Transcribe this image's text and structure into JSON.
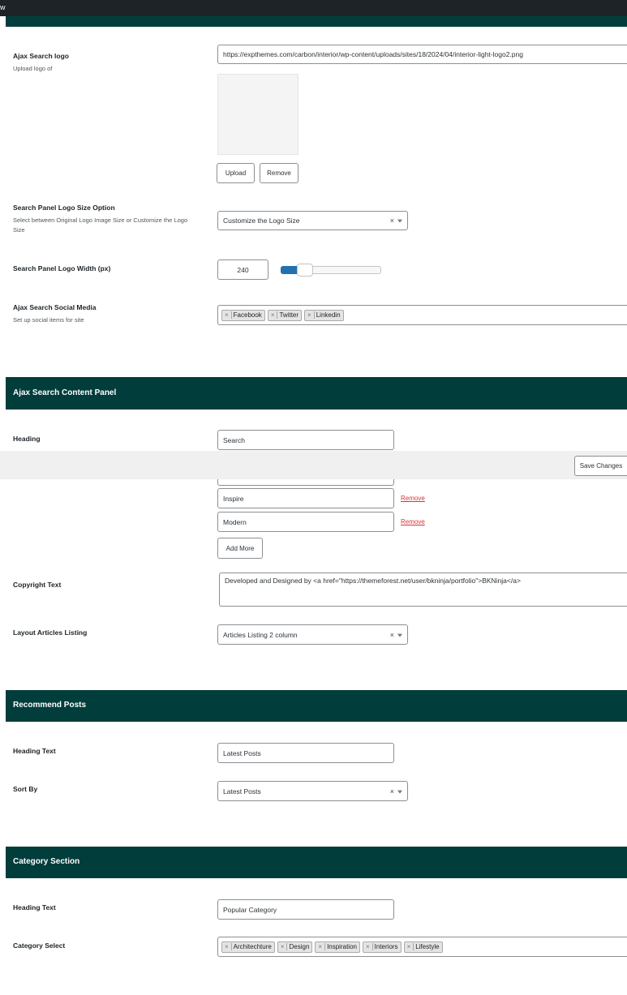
{
  "topbar": {
    "glyph": "w"
  },
  "logo": {
    "label": "Ajax Search logo",
    "desc": "Upload logo of",
    "url": "https://expthemes.com/carbon/interior/wp-content/uploads/sites/18/2024/04/interior-light-logo2.png",
    "upload_label": "Upload",
    "remove_label": "Remove"
  },
  "logo_size": {
    "label": "Search Panel Logo Size Option",
    "desc": "Select between Original Logo Image Size or Customize the Logo Size",
    "value": "Customize the Logo Size"
  },
  "logo_width": {
    "label": "Search Panel Logo Width (px)",
    "value": "240",
    "slider_fraction": 0.24
  },
  "social": {
    "label": "Ajax Search Social Media",
    "desc": "Set up social items for site",
    "tags": [
      "Facebook",
      "Twitter",
      "Linkedin"
    ]
  },
  "content_panel": {
    "title": "Ajax Search Content Panel",
    "heading_label": "Heading",
    "heading_value": "Search",
    "save_label": "Save Changes",
    "items": [
      "Inspire",
      "Modern"
    ],
    "remove_label": "Remove",
    "add_more_label": "Add More",
    "copyright_label": "Copyright Text",
    "copyright_value": "Developed and Designed by <a href=\"https://themeforest.net/user/bkninja/portfolio\">BKNinja</a>",
    "layout_label": "Layout Articles Listing",
    "layout_value": "Articles Listing 2 column"
  },
  "recommend": {
    "title": "Recommend Posts",
    "heading_label": "Heading Text",
    "heading_value": "Latest Posts",
    "sort_label": "Sort By",
    "sort_value": "Latest Posts"
  },
  "category": {
    "title": "Category Section",
    "heading_label": "Heading Text",
    "heading_value": "Popular Category",
    "select_label": "Category Select",
    "tags": [
      "Architechture",
      "Design",
      "Inspiration",
      "Interiors",
      "Lifestyle"
    ]
  },
  "colors": {
    "panel": "#003d3b",
    "remove": "#d63638",
    "slider": "#2271b1"
  },
  "icons": {
    "clear": "close-icon",
    "dropdown": "chevron-down-icon"
  }
}
